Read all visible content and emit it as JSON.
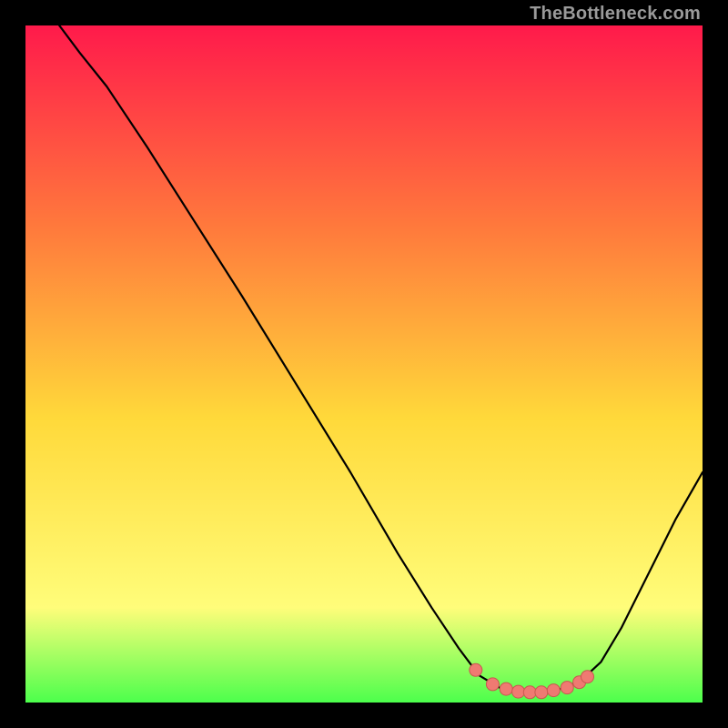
{
  "attribution": "TheBottleneck.com",
  "palette": {
    "gradient_top": "#ff1a4b",
    "gradient_mid_upper": "#ff7a3c",
    "gradient_mid": "#ffd93a",
    "gradient_low": "#fffd7a",
    "gradient_bottom": "#4cff4c",
    "curve": "#000000",
    "dot_fill": "#ef7a72",
    "dot_stroke": "#c8584f",
    "frame": "#000000"
  },
  "chart_data": {
    "type": "line",
    "title": "",
    "xlabel": "",
    "ylabel": "",
    "xlim": [
      0,
      100
    ],
    "ylim": [
      0,
      100
    ],
    "curve": [
      {
        "x": 5,
        "y": 100
      },
      {
        "x": 8,
        "y": 96
      },
      {
        "x": 12,
        "y": 91
      },
      {
        "x": 18,
        "y": 82
      },
      {
        "x": 25,
        "y": 71
      },
      {
        "x": 32,
        "y": 60
      },
      {
        "x": 40,
        "y": 47
      },
      {
        "x": 48,
        "y": 34
      },
      {
        "x": 55,
        "y": 22
      },
      {
        "x": 60,
        "y": 14
      },
      {
        "x": 64,
        "y": 8
      },
      {
        "x": 67,
        "y": 4
      },
      {
        "x": 70,
        "y": 2.2
      },
      {
        "x": 73,
        "y": 1.5
      },
      {
        "x": 76,
        "y": 1.5
      },
      {
        "x": 79,
        "y": 2.0
      },
      {
        "x": 82,
        "y": 3.2
      },
      {
        "x": 85,
        "y": 6
      },
      {
        "x": 88,
        "y": 11
      },
      {
        "x": 92,
        "y": 19
      },
      {
        "x": 96,
        "y": 27
      },
      {
        "x": 100,
        "y": 34
      }
    ],
    "dots": [
      {
        "x": 66.5,
        "y": 4.8
      },
      {
        "x": 69.0,
        "y": 2.7
      },
      {
        "x": 71.0,
        "y": 2.0
      },
      {
        "x": 72.8,
        "y": 1.6
      },
      {
        "x": 74.5,
        "y": 1.5
      },
      {
        "x": 76.2,
        "y": 1.5
      },
      {
        "x": 78.0,
        "y": 1.8
      },
      {
        "x": 80.0,
        "y": 2.2
      },
      {
        "x": 81.8,
        "y": 3.0
      },
      {
        "x": 83.0,
        "y": 3.8
      }
    ]
  }
}
